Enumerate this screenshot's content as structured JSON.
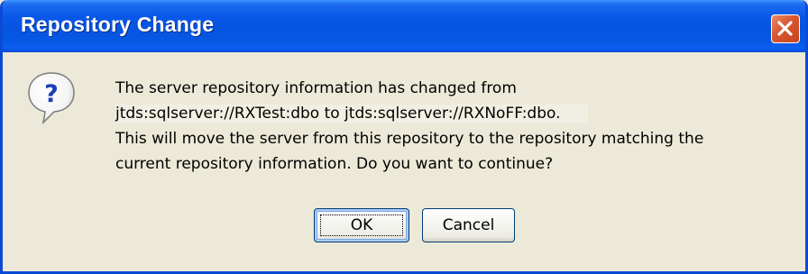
{
  "window": {
    "title": "Repository Change",
    "close_icon": "close-icon"
  },
  "message": {
    "icon": "question-icon",
    "lines": [
      "The server repository information has changed from",
      "jtds:sqlserver://RXTest:dbo to jtds:sqlserver://RXNoFF:dbo.",
      "This will move the server from this repository to the repository matching the",
      "current repository information. Do you want to continue?"
    ]
  },
  "buttons": {
    "ok_label": "OK",
    "cancel_label": "Cancel"
  },
  "colors": {
    "titlebar_blue": "#0654e1",
    "dialog_bg": "#ece9d8",
    "close_red": "#d8562e",
    "button_focus_border": "#003c74"
  }
}
